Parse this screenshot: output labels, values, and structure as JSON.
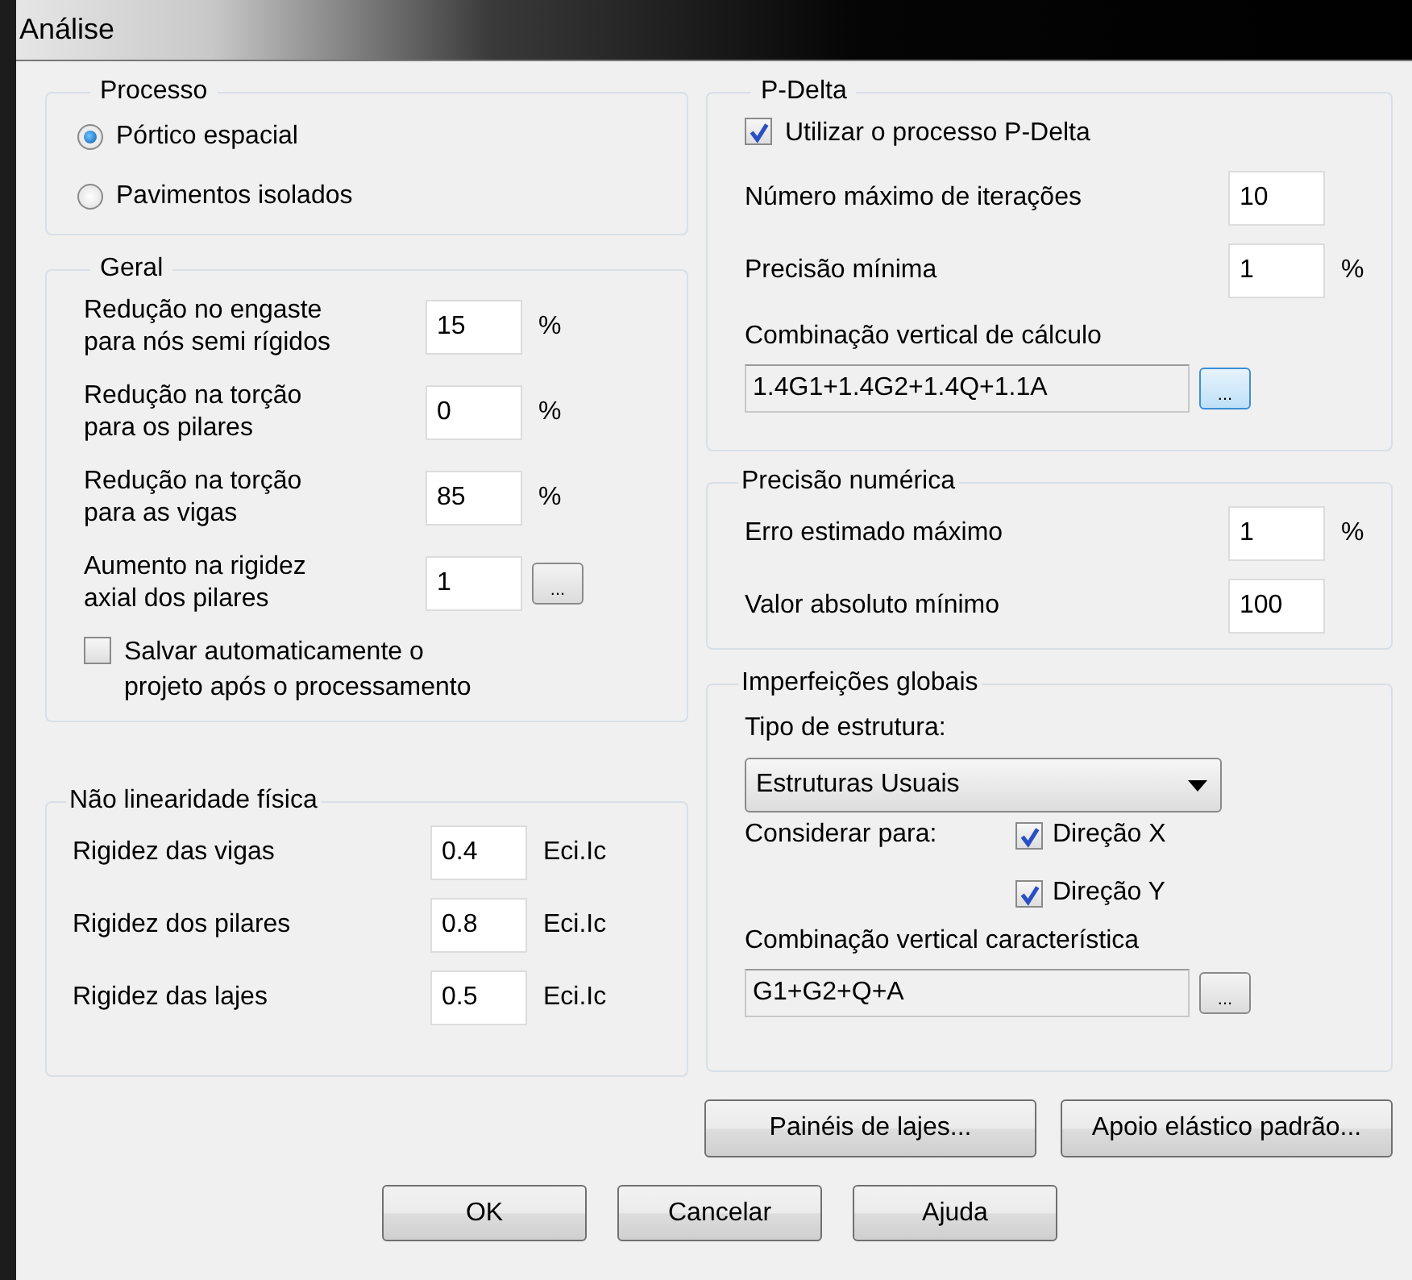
{
  "window": {
    "title": "Análise"
  },
  "left": [
    {
      "title": "Processo",
      "rows": [
        {
          "kind": "radio",
          "label": "Pórtico espacial",
          "selected": true
        },
        {
          "kind": "radio",
          "label": "Pavimentos isolados",
          "selected": false
        }
      ]
    },
    {
      "title": "Geral",
      "rows": [
        {
          "kind": "field",
          "label": "Redução no engaste\npara nós semi rígidos",
          "value": "15",
          "unit": "%"
        },
        {
          "kind": "field",
          "label": "Redução na torção\npara os pilares",
          "value": "0",
          "unit": "%"
        },
        {
          "kind": "field",
          "label": "Redução na torção\npara as vigas",
          "value": "85",
          "unit": "%"
        },
        {
          "kind": "field",
          "label": "Aumento na rigidez\naxial dos pilares",
          "value": "1",
          "button": "..."
        },
        {
          "kind": "checkbox",
          "label": "Salvar automaticamente o\nprojeto após o processamento",
          "checked": false
        }
      ]
    },
    {
      "title": "Não linearidade física",
      "rows": [
        {
          "kind": "field",
          "label": "Rigidez das vigas",
          "value": "0.4",
          "unit": "Eci.Ic"
        },
        {
          "kind": "field",
          "label": "Rigidez dos pilares",
          "value": "0.8",
          "unit": "Eci.Ic"
        },
        {
          "kind": "field",
          "label": "Rigidez das lajes",
          "value": "0.5",
          "unit": "Eci.Ic"
        }
      ]
    }
  ],
  "right": [
    {
      "title": "P-Delta",
      "rows": [
        {
          "kind": "checkbox",
          "label": "Utilizar o processo P-Delta",
          "checked": true
        },
        {
          "kind": "field",
          "label": "Número máximo de iterações",
          "value": "10"
        },
        {
          "kind": "field",
          "label": "Precisão mínima",
          "value": "1",
          "unit": "%"
        },
        {
          "kind": "label",
          "label": "Combinação vertical de cálculo"
        },
        {
          "kind": "combo",
          "value": "1.4G1+1.4G2+1.4Q+1.1A",
          "button": "...",
          "focused": true
        }
      ]
    },
    {
      "title": "Precisão numérica",
      "rows": [
        {
          "kind": "field",
          "label": "Erro estimado máximo",
          "value": "1",
          "unit": "%"
        },
        {
          "kind": "field",
          "label": "Valor absoluto mínimo",
          "value": "100"
        }
      ]
    },
    {
      "title": "Imperfeições globais",
      "rows": [
        {
          "kind": "label",
          "label": "Tipo de estrutura:"
        },
        {
          "kind": "select",
          "value": "Estruturas Usuais"
        },
        {
          "kind": "checks",
          "label": "Considerar para:",
          "options": [
            {
              "label": "Direção X",
              "checked": true
            },
            {
              "label": "Direção Y",
              "checked": true
            }
          ]
        },
        {
          "kind": "label",
          "label": "Combinação vertical característica"
        },
        {
          "kind": "combo",
          "value": "G1+G2+Q+A",
          "button": "...",
          "focused": false
        }
      ]
    }
  ],
  "extra_buttons": [
    "Painéis de lajes...",
    "Apoio elástico padrão..."
  ],
  "buttons": [
    "OK",
    "Cancelar",
    "Ajuda"
  ]
}
